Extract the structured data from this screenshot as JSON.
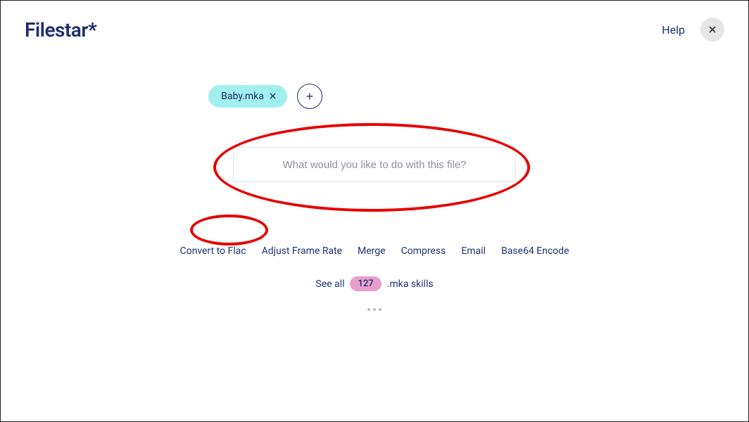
{
  "header": {
    "logo_label": "Filestar",
    "logo_star": "*",
    "help_label": "Help"
  },
  "file": {
    "name": "Baby.mka"
  },
  "search": {
    "placeholder": "What would you like to do with this file?"
  },
  "suggestions": {
    "items": [
      "Convert to Flac",
      "Adjust Frame Rate",
      "Merge",
      "Compress",
      "Email",
      "Base64 Encode"
    ]
  },
  "see_all": {
    "prefix": "See all",
    "count": "127",
    "suffix": ".mka skills"
  }
}
